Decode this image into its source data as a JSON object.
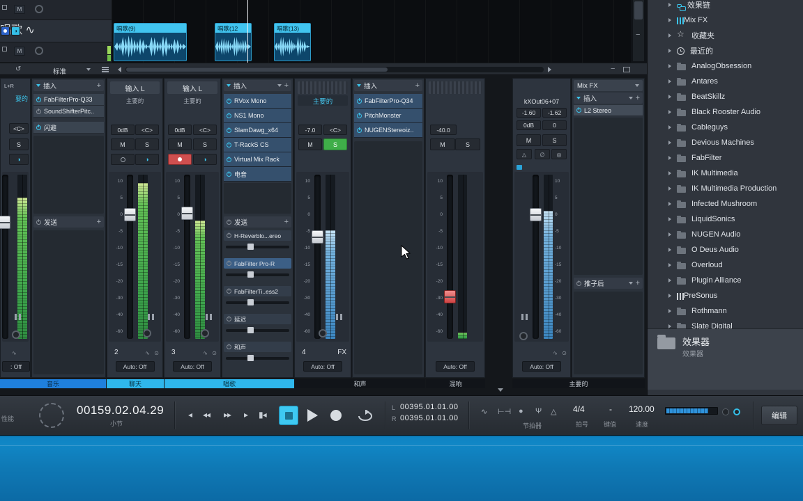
{
  "arrange": {
    "track_name": "唱歌",
    "mute_label": "M",
    "clips": [
      {
        "name": "唱歌(9)"
      },
      {
        "name": "唱歌(12"
      },
      {
        "name": "唱歌(13)"
      }
    ],
    "toolbar": {
      "mode_label": "标准"
    }
  },
  "mixer": {
    "db_scale": "10\n5\n0\n-5\n-10\n-15\n-20\n-30\n-40\n-60",
    "chA": {
      "route": "L+R",
      "out": "要的",
      "pan": "<C>",
      "solo": "S",
      "auto": ": Off"
    },
    "chB": {
      "inserts_label": "插入",
      "items": [
        {
          "label": "FabFilterPro-Q33"
        },
        {
          "label": "SoundShifterPitc.."
        }
      ],
      "duck_label": "闪避",
      "sends_label": "发送"
    },
    "ch2": {
      "name": "输入 L",
      "out": "主要的",
      "gain": "0dB",
      "pan": "<C>",
      "mute": "M",
      "solo": "S",
      "num": "2",
      "auto": "Auto: Off"
    },
    "ch3": {
      "name": "输入 L",
      "out": "主要的",
      "gain": "0dB",
      "pan": "<C>",
      "mute": "M",
      "solo": "S",
      "num": "3",
      "auto": "Auto: Off"
    },
    "chE": {
      "inserts_label": "插入",
      "items": [
        {
          "label": "RVox Mono"
        },
        {
          "label": "NS1 Mono"
        },
        {
          "label": "SlamDawg_x64"
        },
        {
          "label": "T-RackS CS"
        },
        {
          "label": "Virtual Mix Rack"
        },
        {
          "label": "电音"
        }
      ],
      "sends_label": "发送",
      "sends": [
        {
          "label": "H-Reverblo...ereo",
          "cls": ""
        },
        {
          "label": "FabFilter Pro-R",
          "cls": "active"
        },
        {
          "label": "FabFilterTi..ess2",
          "cls": ""
        },
        {
          "label": "延迟",
          "cls": ""
        },
        {
          "label": "和声",
          "cls": ""
        }
      ]
    },
    "ch4": {
      "out": "主要的",
      "gain": "-7.0",
      "pan": "<C>",
      "mute": "M",
      "solo": "S",
      "num": "4",
      "auto": "Auto: Off",
      "fx": "FX"
    },
    "chG": {
      "inserts_label": "插入",
      "items": [
        {
          "label": "FabFilterPro-Q34"
        },
        {
          "label": "PitchMonster"
        },
        {
          "label": "NUGENStereoiz.."
        }
      ]
    },
    "chH": {
      "gain": "-40.0",
      "mute": "M",
      "solo": "S",
      "auto": "Auto: Off"
    },
    "chMain": {
      "title": "kXOut06+07",
      "v1": "-1.60",
      "v2": "-1.62",
      "gain": "0dB",
      "gain2": "0",
      "mute": "M",
      "solo": "S",
      "auto": "Auto: Off"
    },
    "chJ": {
      "mixfx_label": "Mix FX",
      "inserts_label": "插入",
      "item": "L2 Stereo",
      "post_label": "推子后"
    },
    "track_labels": [
      {
        "label": "音乐"
      },
      {
        "label": "聊天"
      },
      {
        "label": "唱歌"
      },
      {
        "label": "和声"
      },
      {
        "label": "混响"
      },
      {
        "label": "主要的"
      }
    ]
  },
  "sidebar": {
    "items": [
      {
        "label": "效果链",
        "icon": "chain"
      },
      {
        "label": "Mix FX",
        "icon": "grid"
      },
      {
        "label": "收藏夹",
        "icon": "star"
      },
      {
        "label": "最近的",
        "icon": "clock"
      },
      {
        "label": "AnalogObsession",
        "icon": "folder"
      },
      {
        "label": "Antares",
        "icon": "folder"
      },
      {
        "label": "BeatSkillz",
        "icon": "folder"
      },
      {
        "label": "Black Rooster Audio",
        "icon": "folder"
      },
      {
        "label": "Cableguys",
        "icon": "folder"
      },
      {
        "label": "Devious Machines",
        "icon": "folder"
      },
      {
        "label": "FabFilter",
        "icon": "folder"
      },
      {
        "label": "IK Multimedia",
        "icon": "folder"
      },
      {
        "label": "IK Multimedia Production",
        "icon": "folder"
      },
      {
        "label": "Infected Mushroom",
        "icon": "folder"
      },
      {
        "label": "LiquidSonics",
        "icon": "folder"
      },
      {
        "label": "NUGEN Audio",
        "icon": "folder"
      },
      {
        "label": "O Deus Audio",
        "icon": "folder"
      },
      {
        "label": "Overloud",
        "icon": "folder"
      },
      {
        "label": "Plugin Alliance",
        "icon": "folder"
      },
      {
        "label": "PreSonus",
        "icon": "sliders"
      },
      {
        "label": "Rothmann",
        "icon": "folder"
      },
      {
        "label": "Slate Digital",
        "icon": "folder"
      }
    ],
    "footer": {
      "title": "效果器",
      "subtitle": "效果器"
    }
  },
  "transport": {
    "perf_label": "性能",
    "time": "00159.02.04.29",
    "time_unit": "小节",
    "l_label": "L",
    "r_label": "R",
    "loc_l": "00395.01.01.00",
    "loc_r": "00395.01.01.00",
    "metronome_label": "节拍器",
    "sig": "4/4",
    "sig_label": "拍号",
    "key": "-",
    "key_label": "键值",
    "tempo": "120.00",
    "tempo_label": "速度",
    "edit_label": "编辑"
  }
}
